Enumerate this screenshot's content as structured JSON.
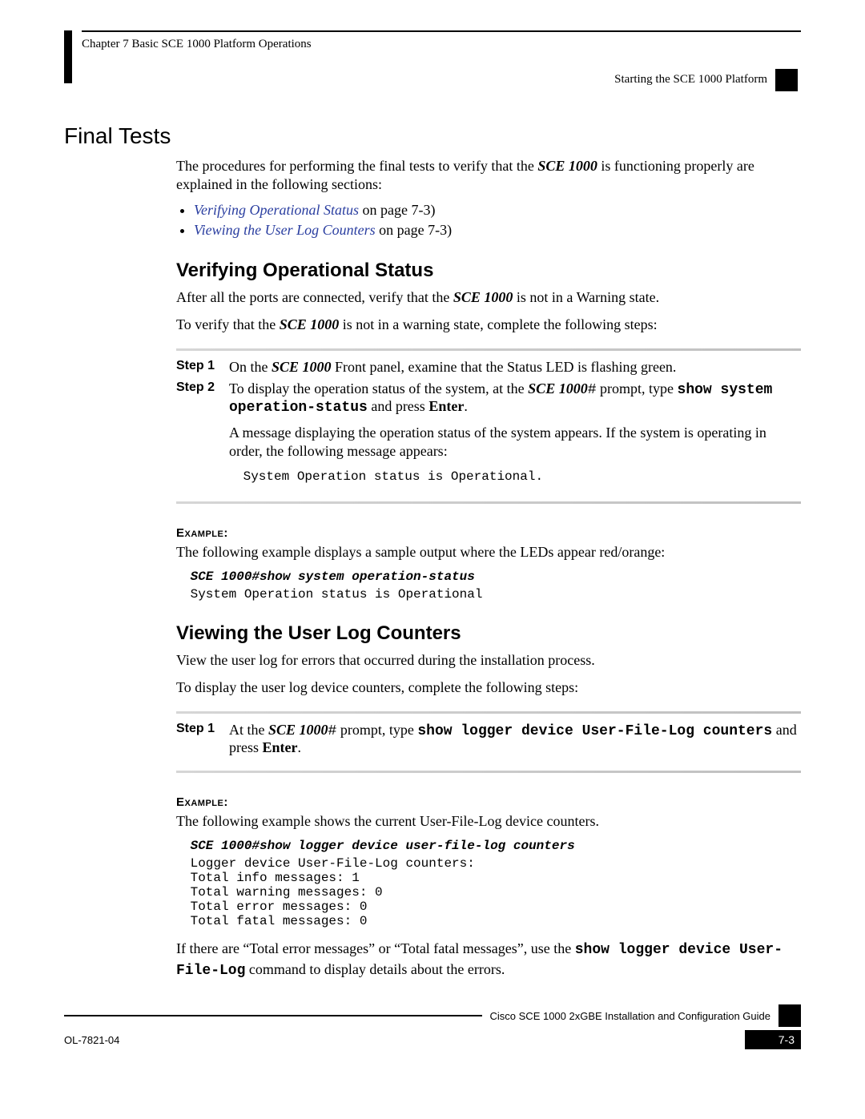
{
  "header": {
    "chapter_line": "Chapter 7      Basic SCE 1000 Platform Operations",
    "right_sub": "Starting the SCE 1000 Platform"
  },
  "section": {
    "title": "Final Tests",
    "intro_a": "The procedures for performing the final tests to verify that the ",
    "intro_device": "SCE 1000",
    "intro_b": " is functioning properly are explained in the following sections:",
    "link1_text": "Verifying Operational Status",
    "link1_suffix": " on page 7-3)",
    "link2_text": "Viewing the User Log Counters",
    "link2_suffix": " on page 7-3)"
  },
  "verify": {
    "heading": "Verifying Operational Status",
    "p1_a": "After all the ports are connected, verify that the ",
    "p1_dev": "SCE 1000",
    "p1_b": " is not in a Warning state.",
    "p2_a": "To verify that the ",
    "p2_dev": "SCE 1000",
    "p2_b": " is not in a warning state, complete the following steps:",
    "step1_label": "Step 1",
    "step1_a": "On the ",
    "step1_dev": "SCE 1000",
    "step1_b": " Front panel, examine that the Status LED is flashing green.",
    "step2_label": "Step 2",
    "step2_a": "To display the operation status of the system, at the ",
    "step2_dev": "SCE 1000",
    "step2_hash": "#",
    "step2_b": " prompt, type ",
    "step2_cmd": "show system operation-status",
    "step2_c": " and press ",
    "step2_enter": "Enter",
    "step2_d": ".",
    "step2_msg": "A message displaying the operation status of the system appears. If the system is operating in order, the following message appears:",
    "step2_out": " System Operation status is Operational.",
    "example_label": "Example:",
    "example_intro": "The following example displays a sample output where the LEDs appear red/orange:",
    "example_cmd": " SCE 1000#show system operation-status",
    "example_out": " System Operation status is Operational"
  },
  "userlog": {
    "heading": "Viewing the User Log Counters",
    "p1": "View the user log for errors that occurred during the installation process.",
    "p2": "To display the user log device counters, complete the following steps:",
    "step1_label": "Step 1",
    "step1_a": "At the ",
    "step1_dev": "SCE 1000",
    "step1_hash": "#",
    "step1_b": " prompt, type ",
    "step1_cmd": "show logger device User-File-Log counters",
    "step1_c": " and press ",
    "step1_enter": "Enter",
    "step1_d": ".",
    "example_label": "Example:",
    "example_intro": "The following example shows the current User-File-Log device counters.",
    "example_cmd": " SCE 1000#show logger device user-file-log counters",
    "example_out": " Logger device User-File-Log counters:\n Total info messages: 1\n Total warning messages: 0\n Total error messages: 0\n Total fatal messages: 0",
    "tail_a": "If there are “Total error messages” or “Total fatal messages”, use the ",
    "tail_cmd": "show logger device User-File-Log",
    "tail_b": " command to display details about the errors."
  },
  "footer": {
    "guide": "Cisco SCE 1000 2xGBE Installation and Configuration Guide",
    "ol": "OL-7821-04",
    "page": "7-3"
  }
}
